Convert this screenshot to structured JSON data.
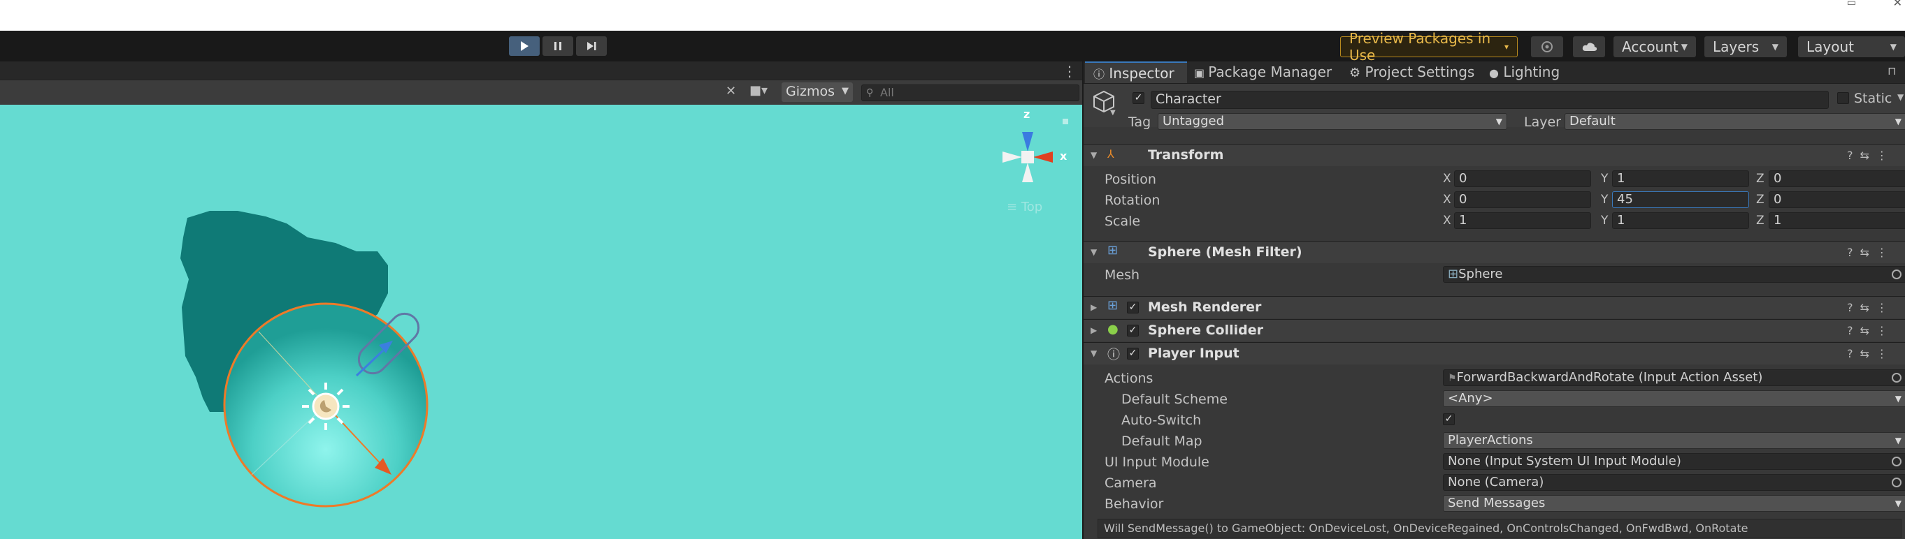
{
  "toolbar": {
    "play_label": "play",
    "pause_label": "pause",
    "step_label": "step",
    "preview_packages": "Preview Packages in Use",
    "account": "Account",
    "layers": "Layers",
    "layout": "Layout"
  },
  "scene": {
    "gizmos": "Gizmos",
    "search_placeholder": "All",
    "orientation_label": "Top",
    "axis_z": "z",
    "axis_x": "x",
    "bg_color": "#65dbd1"
  },
  "inspector": {
    "tabs": [
      "Inspector",
      "Package Manager",
      "Project Settings",
      "Lighting"
    ],
    "object_name": "Character",
    "static_label": "Static",
    "tag_label": "Tag",
    "tag_value": "Untagged",
    "layer_label": "Layer",
    "layer_value": "Default",
    "transform": {
      "title": "Transform",
      "position_label": "Position",
      "rotation_label": "Rotation",
      "scale_label": "Scale",
      "axis_x": "X",
      "axis_y": "Y",
      "axis_z": "Z",
      "position": [
        "0",
        "1",
        "0"
      ],
      "rotation": [
        "0",
        "45",
        "0"
      ],
      "scale": [
        "1",
        "1",
        "1"
      ]
    },
    "mesh_filter": {
      "title": "Sphere (Mesh Filter)",
      "mesh_label": "Mesh",
      "mesh_value": "Sphere"
    },
    "mesh_renderer": {
      "title": "Mesh Renderer"
    },
    "sphere_collider": {
      "title": "Sphere Collider"
    },
    "player_input": {
      "title": "Player Input",
      "actions_label": "Actions",
      "actions_value": "ForwardBackwardAndRotate (Input Action Asset)",
      "default_scheme_label": "Default Scheme",
      "default_scheme_value": "<Any>",
      "auto_switch_label": "Auto-Switch",
      "default_map_label": "Default Map",
      "default_map_value": "PlayerActions",
      "ui_input_module_label": "UI Input Module",
      "ui_input_module_value": "None (Input System UI Input Module)",
      "camera_label": "Camera",
      "camera_value": "None (Camera)",
      "behavior_label": "Behavior",
      "behavior_value": "Send Messages",
      "info_text": "Will SendMessage() to GameObject: OnDeviceLost, OnDeviceRegained, OnControlsChanged, OnFwdBwd, OnRotate"
    }
  }
}
